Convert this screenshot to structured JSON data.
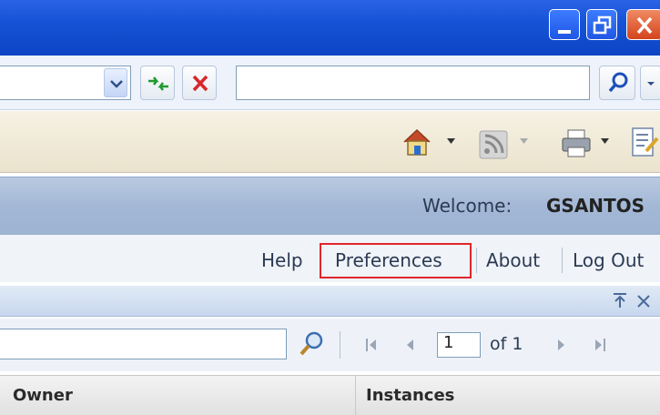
{
  "window": {
    "controls": [
      "minimize-icon",
      "restore-icon",
      "close-icon"
    ]
  },
  "toolbar": {
    "icons": [
      "dropdown-icon",
      "refresh-icon",
      "stop-icon",
      "search-icon",
      "home-icon",
      "feeds-icon",
      "print-icon",
      "page-icon"
    ]
  },
  "header": {
    "welcome_label": "Welcome:",
    "username": "GSANTOS"
  },
  "links": {
    "help": "Help",
    "preferences": "Preferences",
    "about": "About",
    "logout": "Log Out"
  },
  "pager": {
    "page_value": "1",
    "of_text": "of 1"
  },
  "table": {
    "columns": [
      "Owner",
      "Instances"
    ]
  },
  "colors": {
    "highlight": "#e0262b",
    "titlebar": "#1553d6"
  }
}
